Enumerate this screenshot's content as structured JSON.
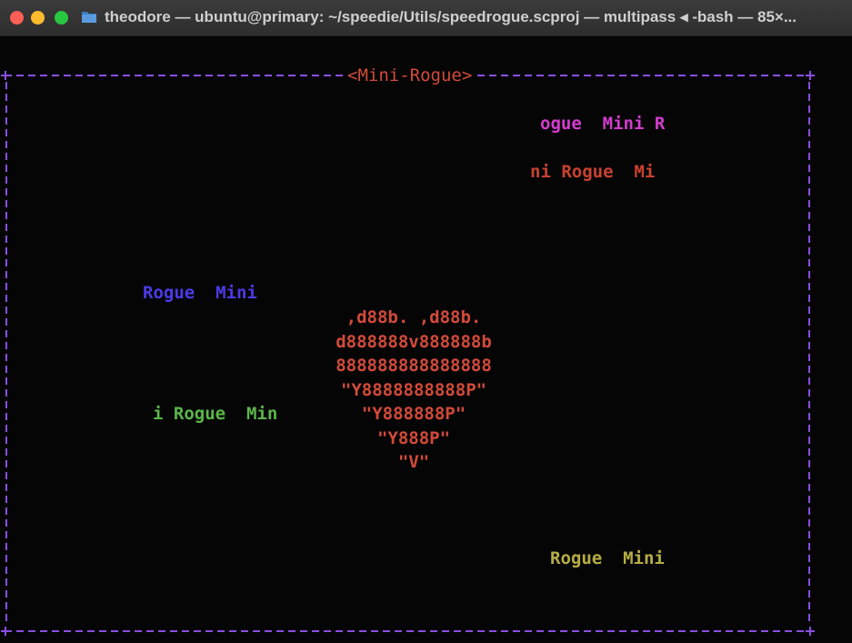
{
  "window": {
    "title": "theodore — ubuntu@primary: ~/speedie/Utils/speedrogue.scproj — multipass ◂ -bash — 85×..."
  },
  "game": {
    "title": "<Mini-Rogue>",
    "border_color": "#8a4ee0",
    "floating_texts": [
      {
        "text": "ogue  Mini R",
        "color": "#d43ccf"
      },
      {
        "text": "ni Rogue  Mi",
        "color": "#c9412f"
      },
      {
        "text": "Rogue  Mini",
        "color": "#4b3be8"
      },
      {
        "text": "i Rogue  Min",
        "color": "#5bb64a"
      },
      {
        "text": "Rogue  Mini",
        "color": "#b7ad45"
      }
    ],
    "heart_color": "#d24a3a",
    "heart": [
      ",d88b. ,d88b.",
      "d888888v888888b",
      "888888888888888",
      "\"Y8888888888P\"",
      "\"Y888888P\"",
      "\"Y888P\"",
      "\"V\""
    ]
  },
  "colors": {
    "close": "#fe5f57",
    "minimize": "#febc2e",
    "zoom": "#28c840",
    "title_label": "#d24a3a"
  }
}
